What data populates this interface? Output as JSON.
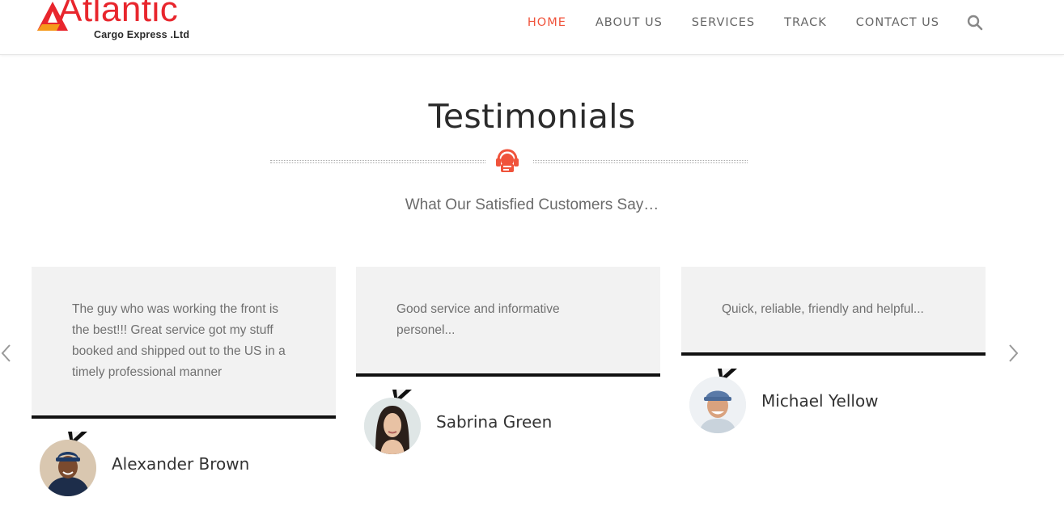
{
  "brand": {
    "name": "Atlantic",
    "tagline": "Cargo Express .Ltd",
    "colors": {
      "primary": "#e8262d",
      "accent": "#f59a1b",
      "nav_active": "#f0533b"
    }
  },
  "nav": {
    "items": [
      {
        "label": "HOME",
        "active": true
      },
      {
        "label": "ABOUT US",
        "active": false
      },
      {
        "label": "SERVICES",
        "active": false
      },
      {
        "label": "TRACK",
        "active": false
      },
      {
        "label": "CONTACT US",
        "active": false
      }
    ],
    "search_icon": "search-icon"
  },
  "section": {
    "title": "Testimonials",
    "divider_icon": "headset-support-icon",
    "subtitle": "What Our Satisfied Customers Say…"
  },
  "carousel": {
    "prev_icon": "chevron-left-icon",
    "next_icon": "chevron-right-icon"
  },
  "testimonials": [
    {
      "quote": "The guy who was working the front is the best!!! Great service got my stuff booked and shipped out to the US in a timely professional manner",
      "name": "Alexander Brown"
    },
    {
      "quote": "Good service and informative personel...",
      "name": "Sabrina Green"
    },
    {
      "quote": "Quick, reliable, friendly and helpful...",
      "name": "Michael Yellow"
    }
  ]
}
